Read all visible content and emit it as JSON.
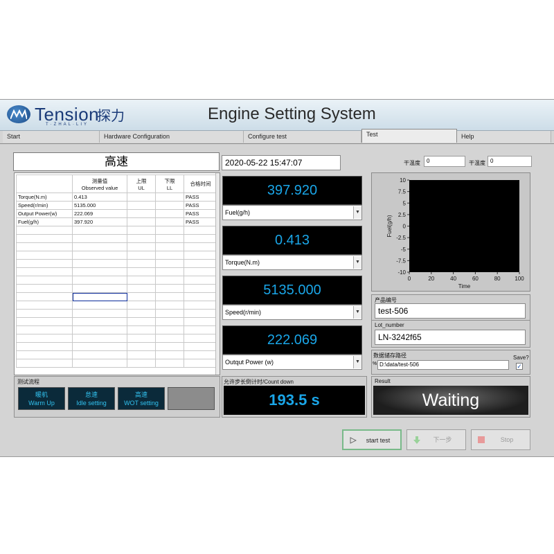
{
  "app": {
    "title": "Engine Setting System",
    "logo_text": "Tension",
    "logo_cn": "探力",
    "logo_sub": "T·ZHAL·LIY"
  },
  "tabs": [
    {
      "label": "Start"
    },
    {
      "label": "Hardware Configuration"
    },
    {
      "label": "Configure test"
    },
    {
      "label": "Test"
    },
    {
      "label": "Help"
    }
  ],
  "mode_display": "高速",
  "datetime": "2020-05-22 15:47:07",
  "temps": [
    {
      "label": "干温度",
      "value": "0"
    },
    {
      "label": "干温度",
      "value": "0"
    }
  ],
  "table": {
    "headers": [
      {
        "line1": "",
        "line2": ""
      },
      {
        "line1": "测量值",
        "line2": "Observed value"
      },
      {
        "line1": "上限",
        "line2": "UL"
      },
      {
        "line1": "下限",
        "line2": "LL"
      },
      {
        "line1": "合格时间",
        "line2": ""
      }
    ],
    "rows": [
      [
        "Torque(N.m)",
        "0.413",
        "",
        "",
        "PASS"
      ],
      [
        "Speed(r/min)",
        "5135.000",
        "",
        "",
        "PASS"
      ],
      [
        "Output Power(w)",
        "222.069",
        "",
        "",
        "PASS"
      ],
      [
        "Fuel(g/h)",
        "397.920",
        "",
        "",
        "PASS"
      ]
    ]
  },
  "displays": [
    {
      "value": "397.920",
      "channel": "Fuel(g/h)"
    },
    {
      "value": "0.413",
      "channel": "Torque(N.m)"
    },
    {
      "value": "5135.000",
      "channel": "Speed(r/min)"
    },
    {
      "value": "222.069",
      "channel": "Outqut Power (w)"
    }
  ],
  "chart_data": {
    "type": "line",
    "title": "",
    "xlabel": "Time",
    "ylabel": "Fuel(g/h)",
    "xlim": [
      0,
      100
    ],
    "ylim": [
      -10,
      10
    ],
    "xticks": [
      "0",
      "20",
      "40",
      "60",
      "80",
      "100"
    ],
    "yticks": [
      "10",
      "7.5",
      "5",
      "2.5",
      "0",
      "-2.5",
      "-5",
      "-7.5",
      "-10"
    ],
    "series": [],
    "background": "#000000",
    "grid": false
  },
  "product": {
    "label": "产品编号",
    "value": "test-506"
  },
  "lot": {
    "label": "Lot_number",
    "value": "LN-3242f65"
  },
  "storage": {
    "label": "数据储存路径",
    "path": "D:\\data/test-506",
    "save_label": "Save?",
    "save_checked": true
  },
  "flow": {
    "label": "测试流程",
    "steps": [
      {
        "cn": "暖机",
        "en": "Warm Up"
      },
      {
        "cn": "怠速",
        "en": "Idle setting"
      },
      {
        "cn": "高速",
        "en": "WOT setting"
      }
    ]
  },
  "countdown": {
    "label": "允许步长倒计时/Count down",
    "value": "193.5  s"
  },
  "result": {
    "label": "Result",
    "value": "Waiting"
  },
  "buttons": {
    "start": "start test",
    "next": "下一步",
    "stop": "Stop"
  },
  "colors": {
    "display_text": "#1aa6e8",
    "flow_text": "#32c2f0",
    "panel_bg": "#d4d4d4"
  }
}
